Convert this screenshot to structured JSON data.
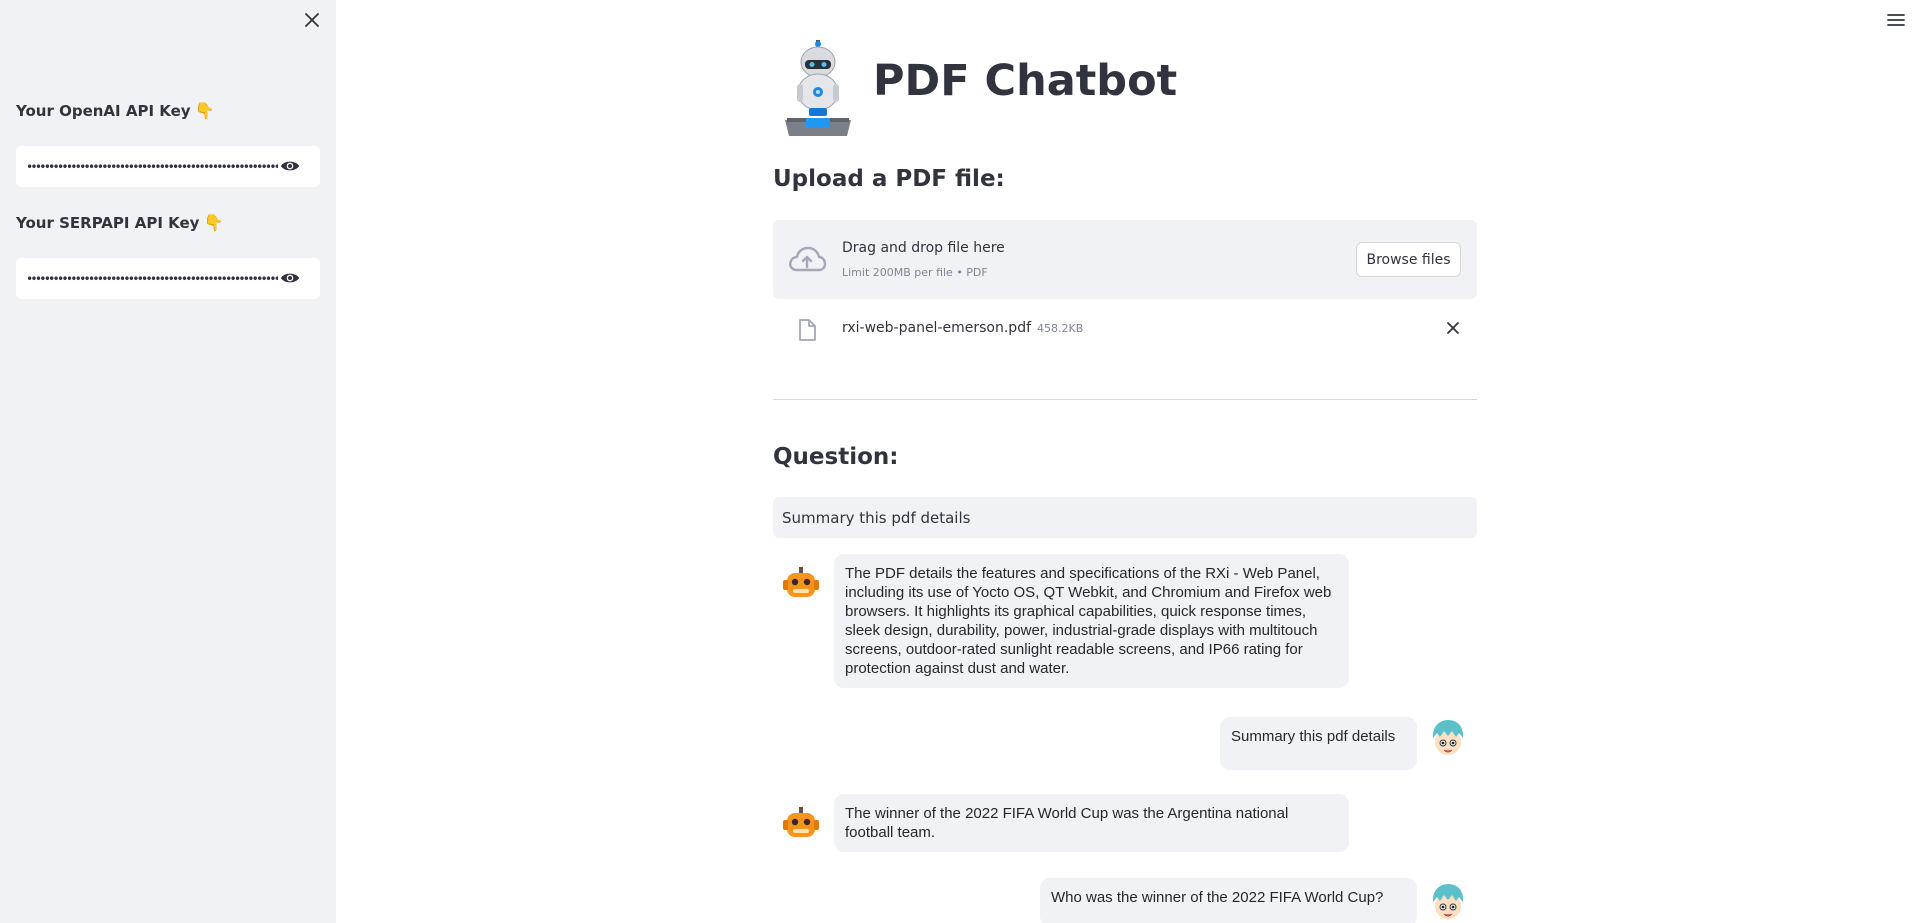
{
  "sidebar": {
    "openai_label": "Your OpenAI API Key",
    "openai_value": "••••••••••••••••••••••••••••••••••••••••••••••••••••••••••••",
    "serpapi_label": "Your SERPAPI API Key",
    "serpapi_value": "••••••••••••••••••••••••••••••••••••••••••••••••••••••••••••",
    "hand_emoji": "👇"
  },
  "main": {
    "title": "PDF Chatbot",
    "upload_heading": "Upload a PDF file:",
    "dropzone": {
      "title": "Drag and drop file here",
      "subtitle": "Limit 200MB per file • PDF",
      "browse_label": "Browse files"
    },
    "file": {
      "name": "rxi-web-panel-emerson.pdf",
      "size": "458.2KB"
    },
    "question_heading": "Question:",
    "question_value": "Summary this pdf details"
  },
  "chat": [
    {
      "role": "bot",
      "text": "The PDF details the features and specifications of the RXi - Web Panel, including its use of Yocto OS, QT Webkit, and Chromium and Firefox web browsers. It highlights its graphical capabilities, quick response times, sleek design, durability, power, industrial-grade displays with multitouch screens, outdoor-rated sunlight readable screens, and IP66 rating for protection against dust and water."
    },
    {
      "role": "user",
      "text": "Summary this pdf details"
    },
    {
      "role": "bot",
      "text": "The winner of the 2022 FIFA World Cup was the Argentina national football team."
    },
    {
      "role": "user",
      "text": "Who was the winner of the 2022 FIFA World Cup?"
    }
  ],
  "colors": {
    "sidebar_bg": "#f0f2f6",
    "bubble_bg": "#f0f2f6",
    "bot_avatar": "#f7941d",
    "user_hair": "#5bc0c9"
  },
  "icons": {
    "sidebar_close": "close-icon",
    "menu": "hamburger-icon",
    "password_toggle": "eye-icon",
    "upload": "cloud-upload-icon",
    "file": "file-icon",
    "remove": "close-icon",
    "logo": "robot-logo",
    "bot_avatar": "bot-avatar",
    "user_avatar": "user-avatar"
  }
}
